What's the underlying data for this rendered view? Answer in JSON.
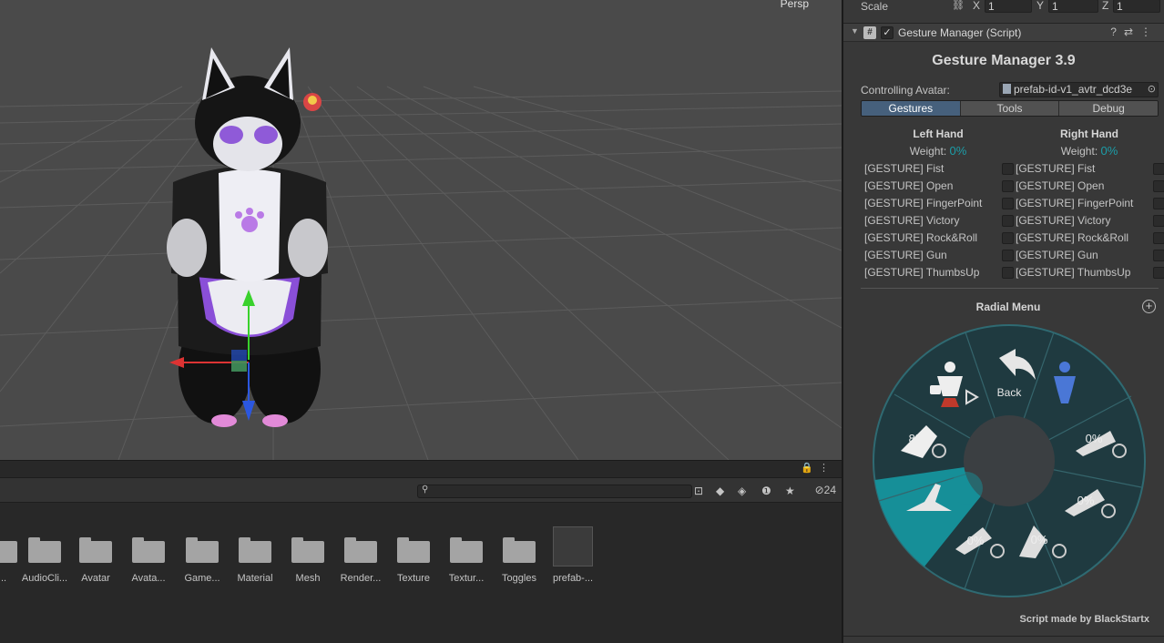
{
  "scene": {
    "projection_label": "Persp"
  },
  "project": {
    "hidden_count": "24",
    "assets": [
      {
        "label": "t...",
        "kind": "folder"
      },
      {
        "label": "AudioCli...",
        "kind": "folder"
      },
      {
        "label": "Avatar",
        "kind": "folder"
      },
      {
        "label": "Avata...",
        "kind": "folder"
      },
      {
        "label": "Game...",
        "kind": "folder"
      },
      {
        "label": "Material",
        "kind": "folder"
      },
      {
        "label": "Mesh",
        "kind": "folder"
      },
      {
        "label": "Render...",
        "kind": "folder"
      },
      {
        "label": "Texture",
        "kind": "folder"
      },
      {
        "label": "Textur...",
        "kind": "folder"
      },
      {
        "label": "Toggles",
        "kind": "folder"
      },
      {
        "label": "prefab-...",
        "kind": "prefab"
      }
    ]
  },
  "inspector": {
    "scale": {
      "label": "Scale",
      "x_label": "X",
      "x": "1",
      "y_label": "Y",
      "y": "1",
      "z_label": "Z",
      "z": "1"
    },
    "component_title": "Gesture Manager (Script)",
    "gm_title": "Gesture Manager 3.9",
    "controlling_label": "Controlling Avatar:",
    "controlling_value": "prefab-id-v1_avtr_dcd3e",
    "tabs": [
      "Gestures",
      "Tools",
      "Debug"
    ],
    "active_tab": 0,
    "left_hand": {
      "title": "Left Hand",
      "weight_label": "Weight:",
      "weight": "0%"
    },
    "right_hand": {
      "title": "Right Hand",
      "weight_label": "Weight:",
      "weight": "0%"
    },
    "gestures": [
      "[GESTURE] Fist",
      "[GESTURE] Open",
      "[GESTURE] FingerPoint",
      "[GESTURE] Victory",
      "[GESTURE] Rock&Roll",
      "[GESTURE] Gun",
      "[GESTURE] ThumbsUp"
    ],
    "radial_title": "Radial Menu",
    "radial": {
      "back_label": "Back",
      "values": {
        "left": "8%",
        "right_top": "0%",
        "right_bottom": "0%",
        "bottom_right": "0%",
        "bottom_left": "0%"
      },
      "accent": "#168f98",
      "ring": "#234248"
    },
    "credit": "Script made by BlackStartx"
  }
}
